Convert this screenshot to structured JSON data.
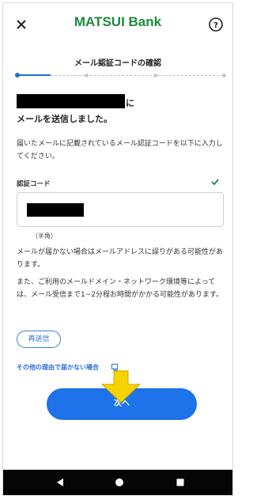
{
  "header": {
    "brand_main": "MATSUI",
    "brand_sub": "Bank",
    "close_icon": "close-icon",
    "help_icon": "help-icon"
  },
  "page": {
    "title": "メール認証コードの確認",
    "step": {
      "current": 1,
      "total": 5
    }
  },
  "message": {
    "line1_suffix": "に",
    "line2": "メールを送信しました。",
    "description": "届いたメールに記載されているメール認証コードを以下に入力してください。"
  },
  "form": {
    "code_label": "認証コード",
    "code_value": "",
    "hint": "（半角）",
    "valid_icon": "check-icon"
  },
  "notes": {
    "note1": "メールが届かない場合はメールアドレスに誤りがある可能性があります。",
    "note2": "また、ご利用のメールドメイン・ネットワーク環境等によっては、メール受信まで1~2分程お時間がかかる可能性があります。"
  },
  "actions": {
    "resend_label": "再送信",
    "other_reason_link": "その他の理由で届かない場合",
    "next_label": "次へ"
  },
  "colors": {
    "brand": "#1a8a3c",
    "accent": "#1e72ea",
    "arrow": "#f6d200"
  }
}
